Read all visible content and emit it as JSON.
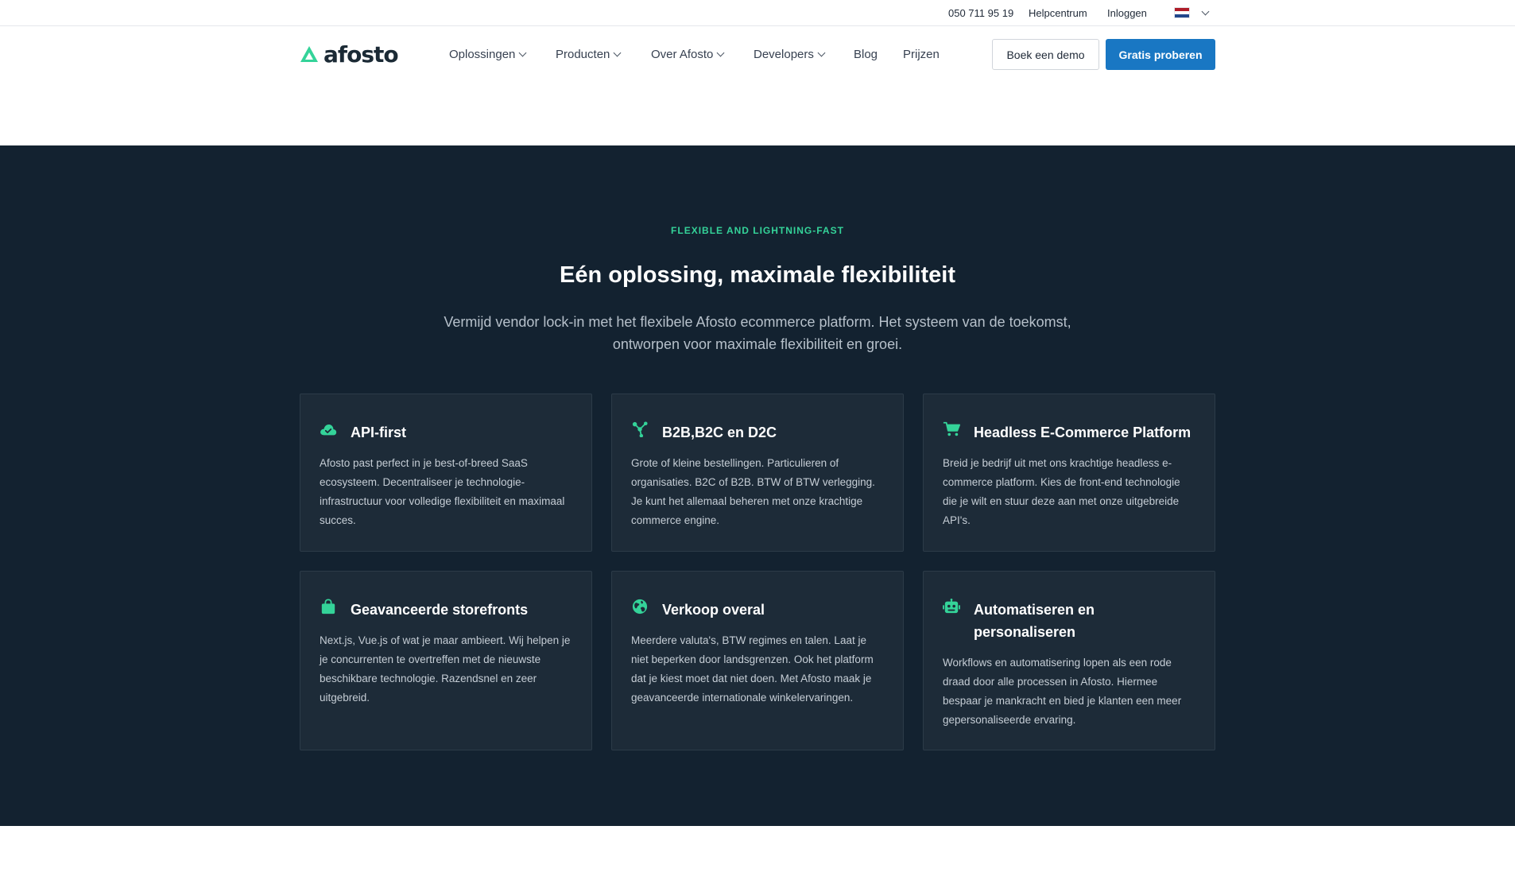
{
  "topbar": {
    "phone": "050 711 95 19",
    "help": "Helpcentrum",
    "login": "Inloggen",
    "language_flag": "netherlands-flag-icon",
    "flag_colors": [
      "#ae1c28",
      "#ffffff",
      "#21468b"
    ]
  },
  "nav": {
    "logo_text": "afosto",
    "items": [
      {
        "label": "Oplossingen",
        "has_dropdown": true
      },
      {
        "label": "Producten",
        "has_dropdown": true
      },
      {
        "label": "Over Afosto",
        "has_dropdown": true
      },
      {
        "label": "Developers",
        "has_dropdown": true
      },
      {
        "label": "Blog",
        "has_dropdown": false
      },
      {
        "label": "Prijzen",
        "has_dropdown": false
      }
    ],
    "demo_button": "Boek een demo",
    "try_button": "Gratis proberen"
  },
  "section": {
    "eyebrow": "FLEXIBLE AND LIGHTNING-FAST",
    "title": "Eén oplossing, maximale flexibiliteit",
    "lead": "Vermijd vendor lock-in met het flexibele Afosto ecommerce platform. Het systeem van de toekomst, ontworpen voor maximale flexibiliteit en groei."
  },
  "features": [
    {
      "icon": "cloud-check-icon",
      "title": "API-first",
      "body": "Afosto past perfect in je best-of-breed SaaS ecosysteem. Decentraliseer je technologie-infrastructuur voor volledige flexibiliteit en maximaal succes."
    },
    {
      "icon": "network-icon",
      "title": "B2B,B2C en D2C",
      "body": "Grote of kleine bestellingen. Particulieren of organisaties. B2C of B2B. BTW of BTW verlegging. Je kunt het allemaal beheren met onze krachtige commerce engine."
    },
    {
      "icon": "shopping-cart-icon",
      "title": "Headless E-Commerce Platform",
      "body": "Breid je bedrijf uit met ons krachtige headless e-commerce platform. Kies de front-end technologie die je wilt en stuur deze aan met onze uitgebreide API's."
    },
    {
      "icon": "shopping-bag-icon",
      "title": "Geavanceerde storefronts",
      "body": "Next.js, Vue.js of wat je maar ambieert. Wij helpen je je concurrenten te overtreffen met de nieuwste beschikbare technologie. Razendsnel en zeer uitgebreid."
    },
    {
      "icon": "globe-icon",
      "title": "Verkoop overal",
      "body": "Meerdere valuta's, BTW regimes en talen. Laat je niet beperken door landsgrenzen. Ook het platform dat je kiest moet dat niet doen. Met Afosto maak je geavanceerde internationale winkelervaringen."
    },
    {
      "icon": "robot-icon",
      "title": "Automatiseren en personaliseren",
      "body": "Workflows en automatisering lopen als een rode draad door alle processen in Afosto. Hiermee bespaar je mankracht en bied je klanten een meer gepersonaliseerde ervaring."
    }
  ],
  "colors": {
    "accent_green": "#34d399",
    "primary_blue": "#1977c3",
    "section_bg": "#132230",
    "card_bg": "#1d2b38"
  }
}
